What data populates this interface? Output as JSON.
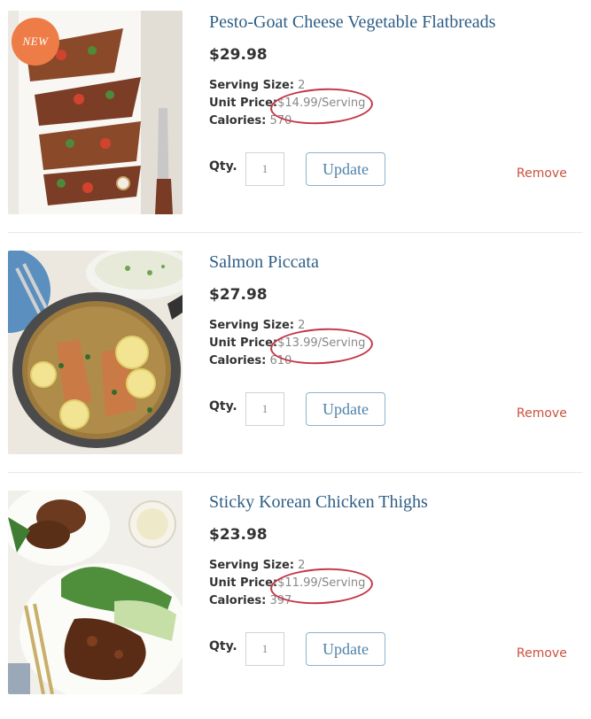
{
  "items": [
    {
      "title": "Pesto-Goat Cheese Vegetable Flatbreads",
      "price": "$29.98",
      "badge": "NEW",
      "serving_size_label": "Serving Size:",
      "serving_size": "2",
      "unit_price_label": "Unit Price:",
      "unit_price": "$14.99/Serving",
      "calories_label": "Calories:",
      "calories": "570",
      "qty_label": "Qty.",
      "qty_value": "1",
      "update_label": "Update",
      "remove_label": "Remove"
    },
    {
      "title": "Salmon Piccata",
      "price": "$27.98",
      "serving_size_label": "Serving Size:",
      "serving_size": "2",
      "unit_price_label": "Unit Price:",
      "unit_price": "$13.99/Serving",
      "calories_label": "Calories:",
      "calories": "610",
      "qty_label": "Qty.",
      "qty_value": "1",
      "update_label": "Update",
      "remove_label": "Remove"
    },
    {
      "title": "Sticky Korean Chicken Thighs",
      "price": "$23.98",
      "serving_size_label": "Serving Size:",
      "serving_size": "2",
      "unit_price_label": "Unit Price:",
      "unit_price": "$11.99/Serving",
      "calories_label": "Calories:",
      "calories": "397",
      "qty_label": "Qty.",
      "qty_value": "1",
      "update_label": "Update",
      "remove_label": "Remove"
    }
  ],
  "colors": {
    "title": "#2e5e86",
    "remove": "#c9513e",
    "badge": "#ee7c47",
    "annotation_circle": "#c4364a",
    "update_border": "#8fb2c9"
  }
}
